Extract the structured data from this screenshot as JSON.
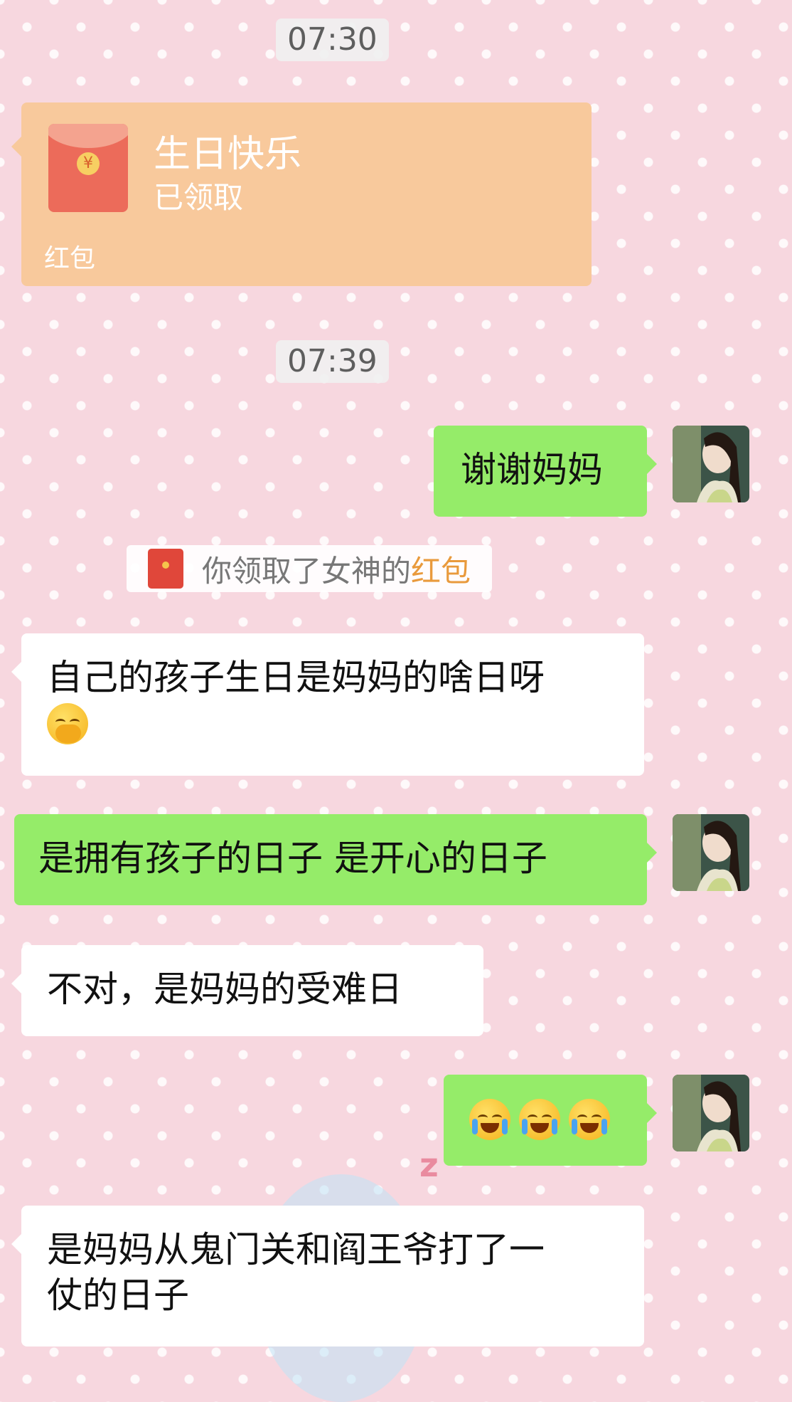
{
  "messages": {
    "time1": "07:30",
    "redpacket": {
      "title": "生日快乐",
      "status": "已领取",
      "footer": "红包",
      "coin_symbol": "¥"
    },
    "time2": "07:39",
    "sent1": "谢谢妈妈",
    "system": {
      "prefix": "你领取了女神的",
      "link": "红包"
    },
    "recv1_line1": "自己的孩子生日是妈妈的啥日呀",
    "sent2": "是拥有孩子的日子 是开心的日子",
    "recv2": "不对，是妈妈的受难日",
    "recv3_line1": "是妈妈从鬼门关和阎王爷打了一",
    "recv3_line2": "仗的日子"
  },
  "icons": {
    "redpacket": "red-envelope-icon",
    "emoji_cover_mouth": "face-with-hand-over-mouth-emoji",
    "emoji_crying": "loudly-crying-face-emoji"
  },
  "colors": {
    "background": "#f7d7df",
    "sent_bubble": "#95ec69",
    "received_bubble": "#ffffff",
    "redpacket_bubble": "#f8c99c",
    "redpacket_link": "#e99a3c"
  }
}
